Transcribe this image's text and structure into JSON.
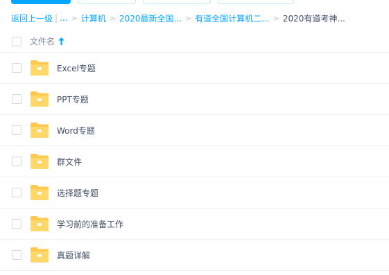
{
  "breadcrumb": {
    "back": "返回上一级",
    "ellipsis": "...",
    "items": [
      "计算机",
      "2020最新全国...",
      "有道全国计算机二..."
    ],
    "current": "2020有道考神..."
  },
  "list_header": {
    "name_label": "文件名",
    "sort": "ascending"
  },
  "files": [
    {
      "name": "Excel专题",
      "type": "folder"
    },
    {
      "name": "PPT专题",
      "type": "folder"
    },
    {
      "name": "Word专题",
      "type": "folder"
    },
    {
      "name": "群文件",
      "type": "folder"
    },
    {
      "name": "选择题专题",
      "type": "folder"
    },
    {
      "name": "学习前的准备工作",
      "type": "folder"
    },
    {
      "name": "真题详解",
      "type": "folder"
    }
  ],
  "colors": {
    "accent": "#06a7ff",
    "folder": "#ffc94f",
    "text": "#424e67"
  }
}
